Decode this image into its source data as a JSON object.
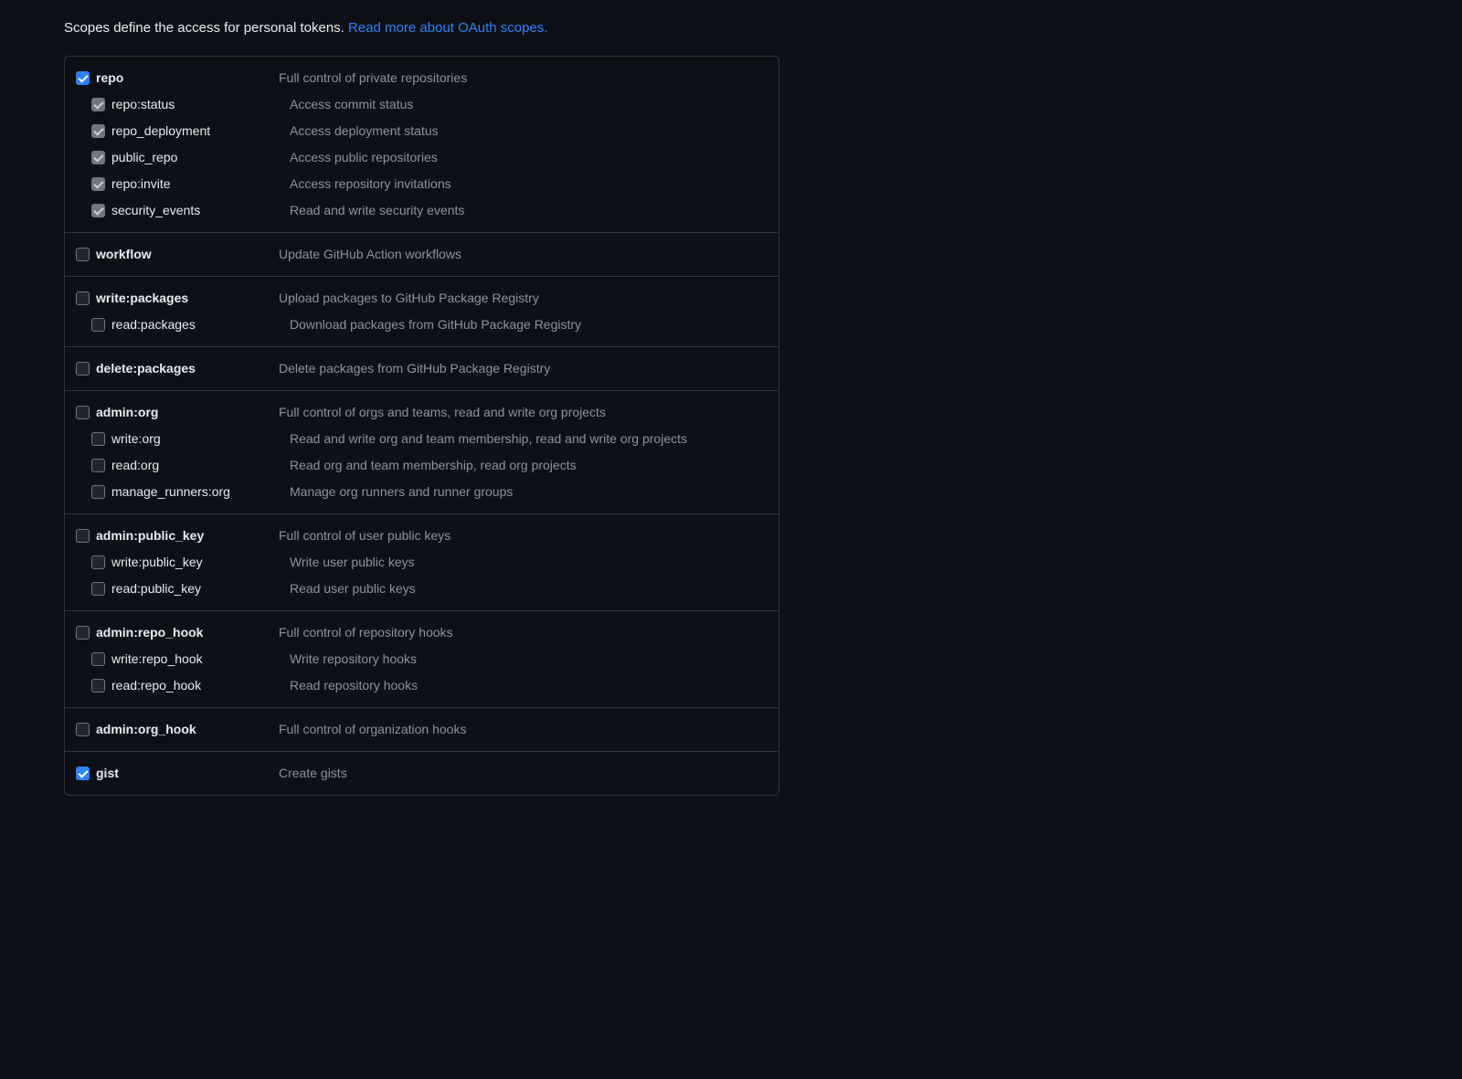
{
  "intro": {
    "text": "Scopes define the access for personal tokens. ",
    "link_text": "Read more about OAuth scopes."
  },
  "groups": [
    {
      "parent": {
        "name": "repo",
        "desc": "Full control of private repositories",
        "checked": true,
        "disabled": false
      },
      "children": [
        {
          "name": "repo:status",
          "desc": "Access commit status",
          "checked": true,
          "disabled": true
        },
        {
          "name": "repo_deployment",
          "desc": "Access deployment status",
          "checked": true,
          "disabled": true
        },
        {
          "name": "public_repo",
          "desc": "Access public repositories",
          "checked": true,
          "disabled": true
        },
        {
          "name": "repo:invite",
          "desc": "Access repository invitations",
          "checked": true,
          "disabled": true
        },
        {
          "name": "security_events",
          "desc": "Read and write security events",
          "checked": true,
          "disabled": true
        }
      ]
    },
    {
      "parent": {
        "name": "workflow",
        "desc": "Update GitHub Action workflows",
        "checked": false,
        "disabled": false
      },
      "children": []
    },
    {
      "parent": {
        "name": "write:packages",
        "desc": "Upload packages to GitHub Package Registry",
        "checked": false,
        "disabled": false
      },
      "children": [
        {
          "name": "read:packages",
          "desc": "Download packages from GitHub Package Registry",
          "checked": false,
          "disabled": false
        }
      ]
    },
    {
      "parent": {
        "name": "delete:packages",
        "desc": "Delete packages from GitHub Package Registry",
        "checked": false,
        "disabled": false
      },
      "children": []
    },
    {
      "parent": {
        "name": "admin:org",
        "desc": "Full control of orgs and teams, read and write org projects",
        "checked": false,
        "disabled": false
      },
      "children": [
        {
          "name": "write:org",
          "desc": "Read and write org and team membership, read and write org projects",
          "checked": false,
          "disabled": false
        },
        {
          "name": "read:org",
          "desc": "Read org and team membership, read org projects",
          "checked": false,
          "disabled": false
        },
        {
          "name": "manage_runners:org",
          "desc": "Manage org runners and runner groups",
          "checked": false,
          "disabled": false
        }
      ]
    },
    {
      "parent": {
        "name": "admin:public_key",
        "desc": "Full control of user public keys",
        "checked": false,
        "disabled": false
      },
      "children": [
        {
          "name": "write:public_key",
          "desc": "Write user public keys",
          "checked": false,
          "disabled": false
        },
        {
          "name": "read:public_key",
          "desc": "Read user public keys",
          "checked": false,
          "disabled": false
        }
      ]
    },
    {
      "parent": {
        "name": "admin:repo_hook",
        "desc": "Full control of repository hooks",
        "checked": false,
        "disabled": false
      },
      "children": [
        {
          "name": "write:repo_hook",
          "desc": "Write repository hooks",
          "checked": false,
          "disabled": false
        },
        {
          "name": "read:repo_hook",
          "desc": "Read repository hooks",
          "checked": false,
          "disabled": false
        }
      ]
    },
    {
      "parent": {
        "name": "admin:org_hook",
        "desc": "Full control of organization hooks",
        "checked": false,
        "disabled": false
      },
      "children": []
    },
    {
      "parent": {
        "name": "gist",
        "desc": "Create gists",
        "checked": true,
        "disabled": false
      },
      "children": []
    }
  ]
}
